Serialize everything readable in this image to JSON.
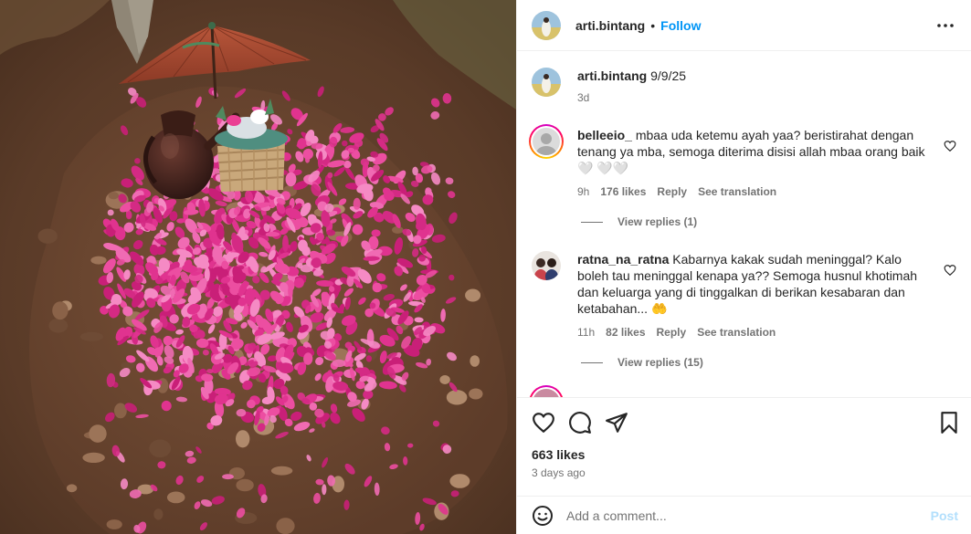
{
  "post": {
    "username": "arti.bintang",
    "separator": "•",
    "follow_label": "Follow",
    "more_icon": "more-horizontal-icon"
  },
  "caption": {
    "username": "arti.bintang",
    "text": "9/9/25",
    "age": "3d"
  },
  "comments": [
    {
      "username": "belleeio_",
      "text": "mbaa uda ketemu ayah yaa? beristirahat dengan tenang ya mba, semoga diterima disisi allah mbaa orang baik🤍 🤍🤍",
      "age": "9h",
      "likes": "176 likes",
      "reply_label": "Reply",
      "translate_label": "See translation",
      "view_replies": "View replies (1)"
    },
    {
      "username": "ratna_na_ratna",
      "text": "Kabarnya kakak sudah meninggal? Kalo boleh tau meninggal kenapa ya?? Semoga husnul khotimah dan keluarga yang di tinggalkan di berikan kesabaran dan ketabahan... 🤲",
      "age": "11h",
      "likes": "82 likes",
      "reply_label": "Reply",
      "translate_label": "See translation",
      "view_replies": "View replies (15)"
    }
  ],
  "actions": {
    "icons": [
      "heart-icon",
      "comment-icon",
      "share-icon",
      "bookmark-icon"
    ]
  },
  "likes": "663 likes",
  "date": "3 days ago",
  "add_comment": {
    "placeholder": "Add a comment...",
    "post_label": "Post"
  },
  "colors": {
    "link_blue": "#0095f6",
    "post_disabled": "#b2dffc",
    "secondary_text": "#737373",
    "petal_pink": "#e0338f"
  }
}
